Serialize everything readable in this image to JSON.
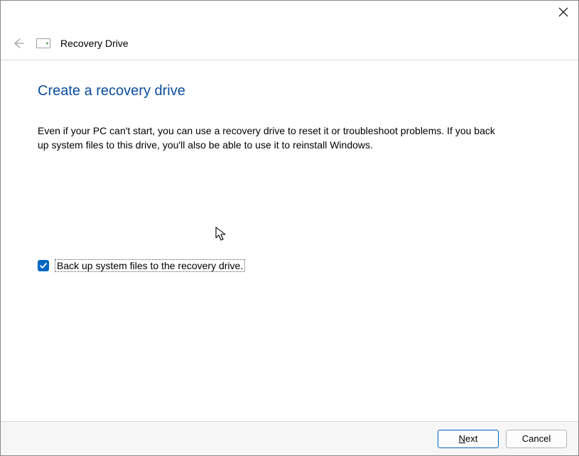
{
  "window": {
    "title": "Recovery Drive"
  },
  "page": {
    "heading": "Create a recovery drive",
    "description": "Even if your PC can't start, you can use a recovery drive to reset it or troubleshoot problems. If you back up system files to this drive, you'll also be able to use it to reinstall Windows."
  },
  "checkbox": {
    "checked": true,
    "label": "Back up system files to the recovery drive."
  },
  "buttons": {
    "next": "Next",
    "cancel": "Cancel"
  }
}
